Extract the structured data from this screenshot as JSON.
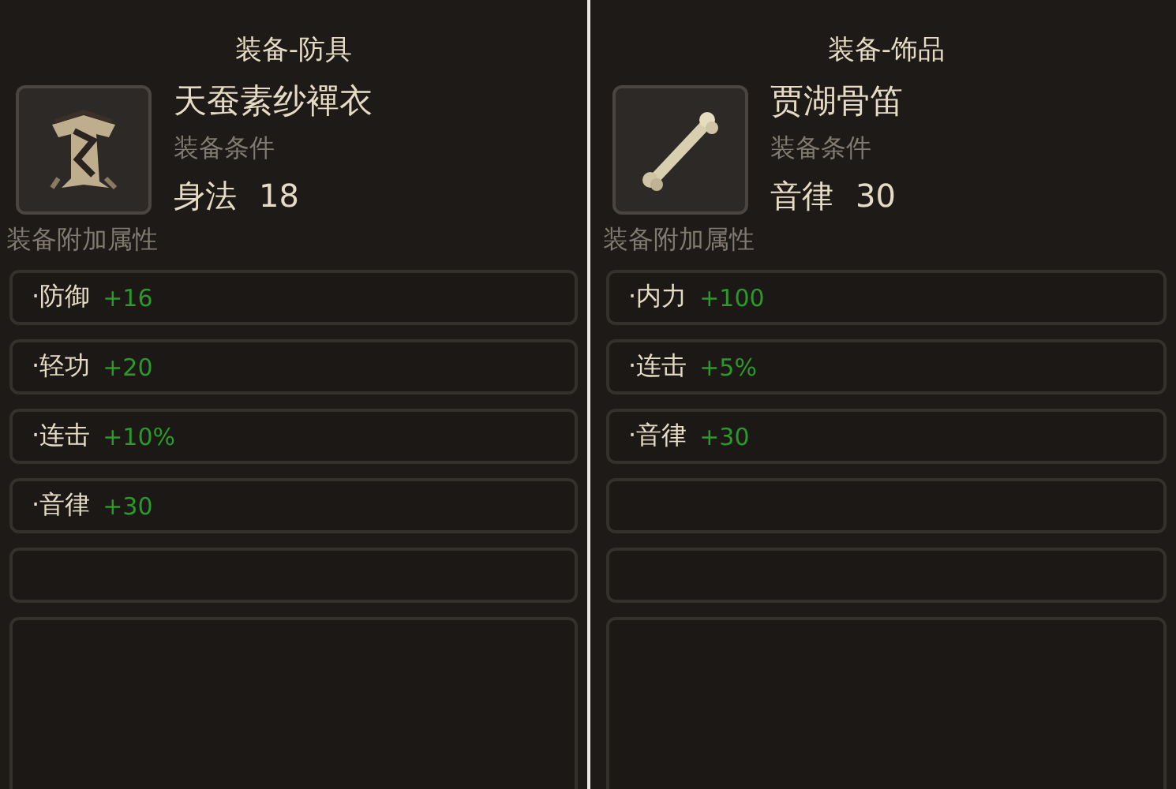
{
  "panels": [
    {
      "category": "装备-防具",
      "item_name": "天蚕素纱襌衣",
      "requirement_label": "装备条件",
      "requirement_stat": "身法",
      "requirement_value": "18",
      "attributes_label": "装备附加属性",
      "attributes": [
        {
          "name": "·防御",
          "value": "+16"
        },
        {
          "name": "·轻功",
          "value": "+20"
        },
        {
          "name": "·连击",
          "value": "+10%"
        },
        {
          "name": "·音律",
          "value": "+30"
        }
      ]
    },
    {
      "category": "装备-饰品",
      "item_name": "贾湖骨笛",
      "requirement_label": "装备条件",
      "requirement_stat": "音律",
      "requirement_value": "30",
      "attributes_label": "装备附加属性",
      "attributes": [
        {
          "name": "·内力",
          "value": "+100"
        },
        {
          "name": "·连击",
          "value": "+5%"
        },
        {
          "name": "·音律",
          "value": "+30"
        }
      ]
    }
  ]
}
